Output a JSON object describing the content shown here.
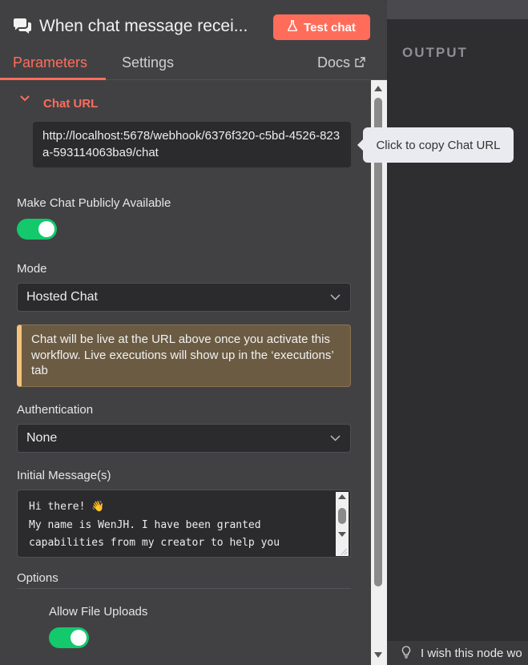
{
  "header": {
    "title": "When chat message recei...",
    "test_button": "Test chat"
  },
  "tabs": {
    "parameters": "Parameters",
    "settings": "Settings",
    "docs": "Docs"
  },
  "chat_url": {
    "label": "Chat URL",
    "value": "http://localhost:5678/webhook/6376f320-c5bd-4526-823a-593114063ba9/chat",
    "tooltip": "Click to copy Chat URL"
  },
  "public": {
    "label": "Make Chat Publicly Available",
    "enabled": true
  },
  "mode": {
    "label": "Mode",
    "value": "Hosted Chat"
  },
  "notice": {
    "text": "Chat will be live at the URL above once you activate this workflow. Live executions will show up in the ‘executions’ tab"
  },
  "authentication": {
    "label": "Authentication",
    "value": "None"
  },
  "initial_messages": {
    "label": "Initial Message(s)",
    "lines": [
      "Hi there! 👋",
      "My name is WenJH. I have been granted",
      "capabilities from my creator to help you"
    ]
  },
  "options": {
    "label": "Options",
    "allow_file_uploads_label": "Allow File Uploads",
    "allow_file_uploads": true
  },
  "output": {
    "label": "OUTPUT",
    "hint": "I wish this node wo"
  },
  "colors": {
    "accent": "#ff6d5a",
    "toggle_on": "#13c96b",
    "notice_bar": "#f5c27a"
  }
}
